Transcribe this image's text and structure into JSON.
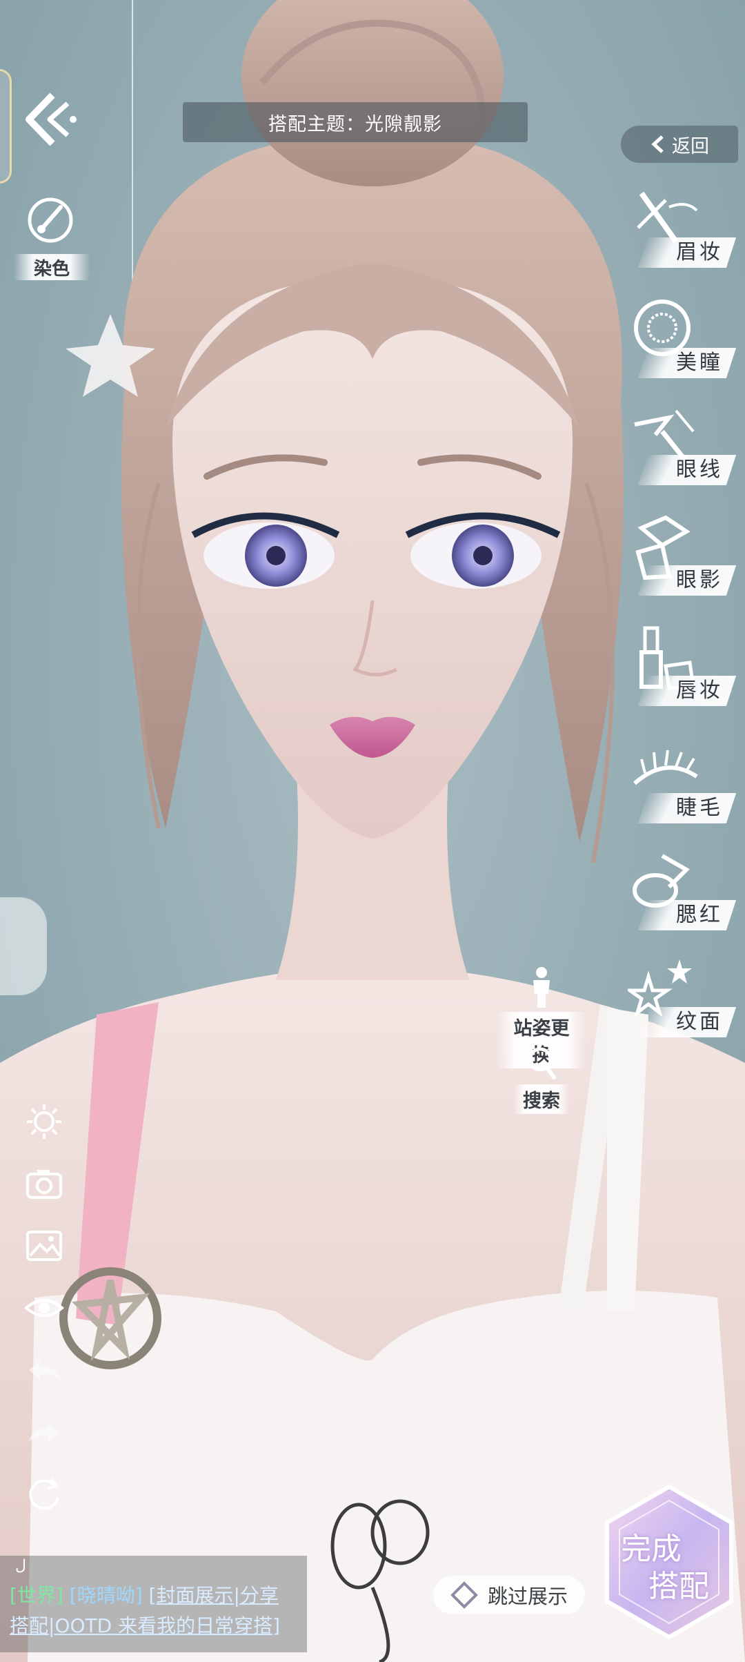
{
  "header": {
    "theme_label": "搭配主题：光隙靓影",
    "return_label": "返回"
  },
  "left_panel": {
    "dye_label": "染色"
  },
  "makeup_menu": {
    "items": [
      {
        "label": "眉妆",
        "icon": "brow-pencil-icon"
      },
      {
        "label": "美瞳",
        "icon": "iris-lens-icon"
      },
      {
        "label": "眼线",
        "icon": "eyeliner-brush-icon"
      },
      {
        "label": "眼影",
        "icon": "eyeshadow-palette-icon"
      },
      {
        "label": "唇妆",
        "icon": "lipstick-icon"
      },
      {
        "label": "睫毛",
        "icon": "eyelash-icon"
      },
      {
        "label": "腮红",
        "icon": "blush-compact-icon"
      },
      {
        "label": "纹面",
        "icon": "stars-icon"
      }
    ]
  },
  "actions": {
    "pose_label": "站姿更换",
    "search_label": "搜索",
    "skip_label": "跳过展示",
    "done_line1": "完成",
    "done_line2": "搭配"
  },
  "tools": [
    "brightness-icon",
    "camera-icon",
    "image-icon",
    "eye-icon",
    "undo-icon",
    "redo-icon",
    "reset-icon"
  ],
  "chat": {
    "corner": "ل",
    "channel": "[世界]",
    "user": "[晓晴呦]",
    "msg_line1": "[封面展示|分享",
    "msg_line2": "搭配|OOTD 来看我的日常穿搭]"
  },
  "colors": {
    "background": "#8fa6ae",
    "hair": "#c7ada4",
    "skin": "#efdcd8",
    "eye": "#8e8fd8",
    "lip": "#d97aa9",
    "strap": "#f2b6c6"
  }
}
